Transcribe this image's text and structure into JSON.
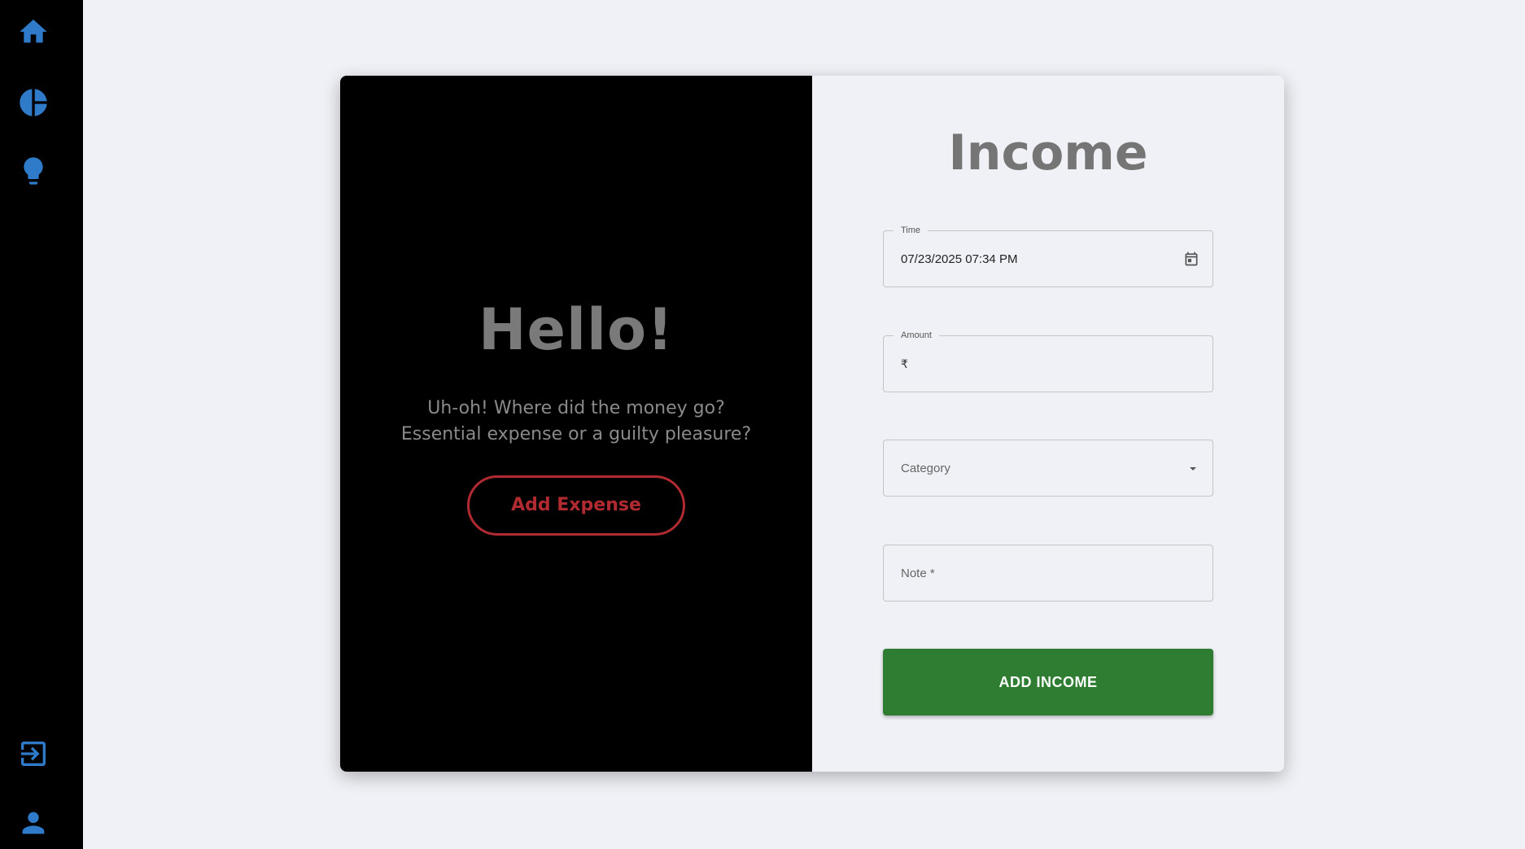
{
  "colors": {
    "sidebar_bg": "#000000",
    "icon_accent": "#2f7bc9",
    "page_bg": "#eff1f6",
    "expense_red": "#b02a31",
    "income_green": "#2e7d32"
  },
  "sidebar": {
    "top_items": [
      {
        "icon": "home-icon"
      },
      {
        "icon": "pie-chart-icon"
      },
      {
        "icon": "lightbulb-icon"
      }
    ],
    "bottom_items": [
      {
        "icon": "login-icon"
      },
      {
        "icon": "person-icon"
      }
    ]
  },
  "left_panel": {
    "heading": "Hello!",
    "message": "Uh-oh! Where did the money go? Essential expense or a guilty pleasure?",
    "button_label": "Add Expense"
  },
  "form": {
    "title": "Income",
    "time": {
      "label": "Time",
      "value": "07/23/2025 07:34 PM",
      "icon": "calendar-icon"
    },
    "amount": {
      "label": "Amount",
      "prefix": "₹",
      "value": ""
    },
    "category": {
      "placeholder": "Category",
      "icon": "arrow-drop-down-icon"
    },
    "note": {
      "placeholder": "Note *"
    },
    "submit_label": "ADD INCOME"
  }
}
